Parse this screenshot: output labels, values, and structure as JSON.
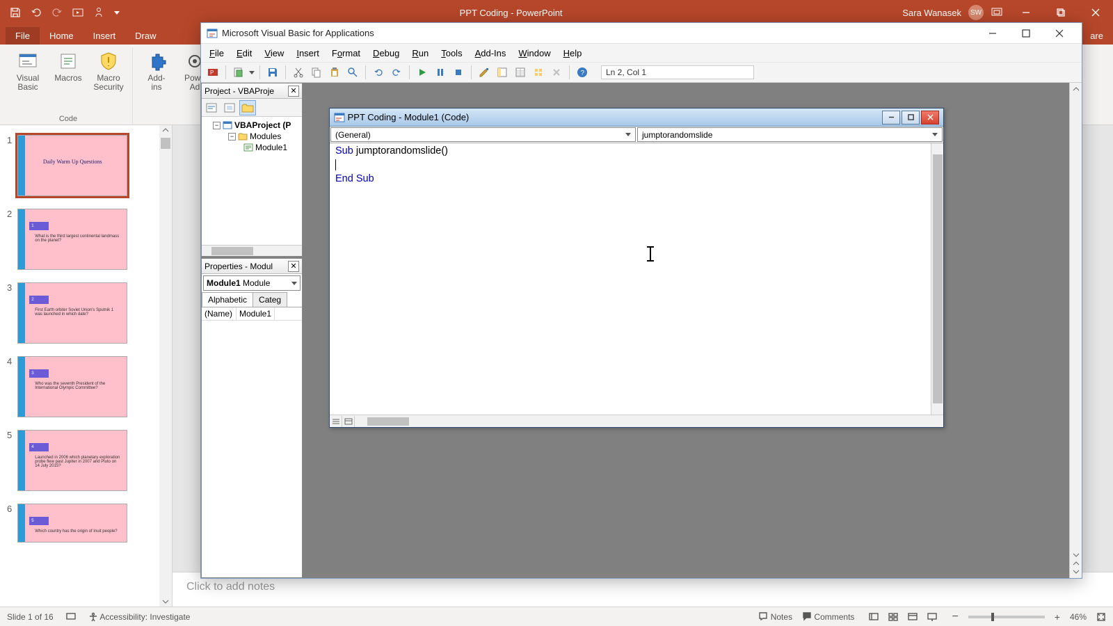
{
  "ppt": {
    "title": "PPT Coding  -  PowerPoint",
    "user_name": "Sara Wanasek",
    "user_initials": "SW",
    "tabs": [
      "File",
      "Home",
      "Insert",
      "Draw"
    ],
    "share": "are",
    "ribbon": {
      "visual_basic": "Visual\nBasic",
      "macros": "Macros",
      "macro_security": "Macro\nSecurity",
      "addins": "Add-\nins",
      "power": "Powe\nAd",
      "code_group": "Code"
    },
    "notes_placeholder": "Click to add notes",
    "status": {
      "slide": "Slide 1 of 16",
      "accessibility": "Accessibility: Investigate",
      "notes_btn": "Notes",
      "comments_btn": "Comments",
      "zoom": "46%"
    },
    "thumbs": [
      {
        "n": "1",
        "title": "Daily Warm Up Questions"
      },
      {
        "n": "2",
        "q": "1",
        "text": "What is the third largest continental landmass on the planet?"
      },
      {
        "n": "3",
        "q": "2",
        "text": "First Earth orbiter Soviet Union's Sputnik 1 was launched in which date?"
      },
      {
        "n": "4",
        "q": "3",
        "text": "Who was the seventh President of the International Olympic Committee?"
      },
      {
        "n": "5",
        "q": "4",
        "text": "Launched in 2006 which planetary exploration probe flew past Jupiter in 2007 and Pluto on 14 July 2015?"
      },
      {
        "n": "6",
        "q": "5",
        "text": "Which country has the origin of Inuit people?"
      }
    ]
  },
  "vbe": {
    "title": "Microsoft Visual Basic for Applications",
    "menu": [
      "File",
      "Edit",
      "View",
      "Insert",
      "Format",
      "Debug",
      "Run",
      "Tools",
      "Add-Ins",
      "Window",
      "Help"
    ],
    "lncol": "Ln 2, Col 1",
    "project_pane_title": "Project - VBAProje",
    "project_root": "VBAProject (P",
    "modules_folder": "Modules",
    "module_name": "Module1",
    "props_pane_title": "Properties - Modul",
    "props_combo_bold": "Module1",
    "props_combo_type": "Module",
    "props_tab_alpha": "Alphabetic",
    "props_tab_cat": "Categ",
    "props_name_label": "(Name)",
    "props_name_value": "Module1",
    "code_win_title": "PPT Coding - Module1 (Code)",
    "combo_left": "(General)",
    "combo_right": "jumptorandomslide",
    "code_line1_kw": "Sub ",
    "code_line1_rest": "jumptorandomslide()",
    "code_line3": "End Sub"
  }
}
